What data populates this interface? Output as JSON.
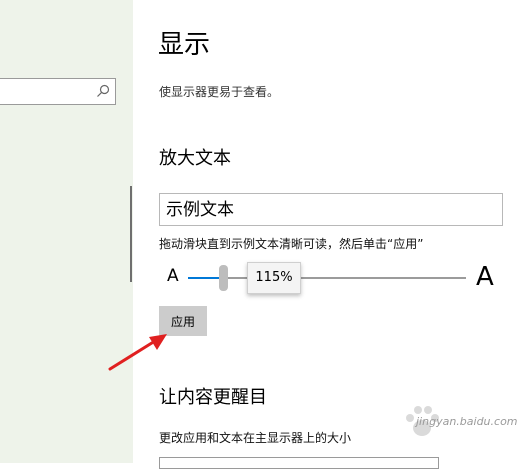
{
  "search": {
    "placeholder": "",
    "icon": "search-icon"
  },
  "page": {
    "title": "显示",
    "subtitle": "使显示器更易于查看。"
  },
  "text_size": {
    "title": "放大文本",
    "sample_text": "示例文本",
    "instruction": "拖动滑块直到示例文本清晰可读，然后单击“应用”",
    "small_a": "A",
    "large_a": "A",
    "slider_value_percent": 115,
    "slider_label": "115%",
    "apply_label": "应用",
    "accent_color": "#0078d7"
  },
  "content": {
    "title": "让内容更醒目",
    "description": "更改应用和文本在主显示器上的大小"
  },
  "annotation": {
    "arrow_color": "#e02020"
  },
  "watermark": {
    "text": "jingyan.baidu.com"
  }
}
